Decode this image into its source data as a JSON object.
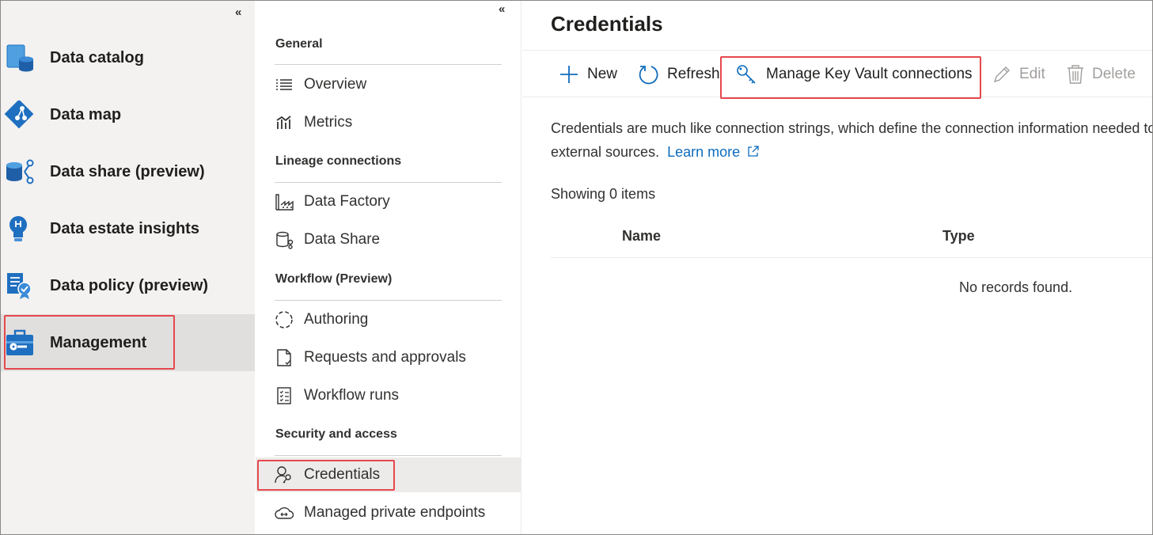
{
  "left_nav": {
    "collapse": "«",
    "items": [
      {
        "label": "Data catalog"
      },
      {
        "label": "Data map"
      },
      {
        "label": "Data share (preview)"
      },
      {
        "label": "Data estate insights"
      },
      {
        "label": "Data policy (preview)"
      },
      {
        "label": "Management"
      }
    ],
    "active": "Management"
  },
  "mid_nav": {
    "collapse": "«",
    "sections": [
      {
        "title": "General",
        "items": [
          "Overview",
          "Metrics"
        ]
      },
      {
        "title": "Lineage connections",
        "items": [
          "Data Factory",
          "Data Share"
        ]
      },
      {
        "title": "Workflow (Preview)",
        "items": [
          "Authoring",
          "Requests and approvals",
          "Workflow runs"
        ]
      },
      {
        "title": "Security and access",
        "items": [
          "Credentials",
          "Managed private endpoints"
        ]
      }
    ],
    "selected": "Credentials"
  },
  "main": {
    "title": "Credentials",
    "toolbar": {
      "new": "New",
      "refresh": "Refresh",
      "manage_kv": "Manage Key Vault connections",
      "edit": "Edit",
      "delete": "Delete"
    },
    "description_line1": "Credentials are much like connection strings, which define the connection information needed to connect to",
    "description_line2": "external sources.",
    "learn_more": "Learn more",
    "showing": "Showing 0 items",
    "columns": [
      "Name",
      "Type"
    ],
    "empty_text": "No records found."
  },
  "colors": {
    "accent": "#0f6cbd",
    "highlight_box": "#e5484d",
    "nav_bg": "#f3f2f1"
  },
  "icons": {
    "data_catalog": "data-catalog-icon",
    "data_map": "data-map-icon",
    "data_share": "data-share-icon",
    "data_estate_insights": "lightbulb-icon",
    "data_policy": "policy-icon",
    "management": "toolbox-icon"
  }
}
